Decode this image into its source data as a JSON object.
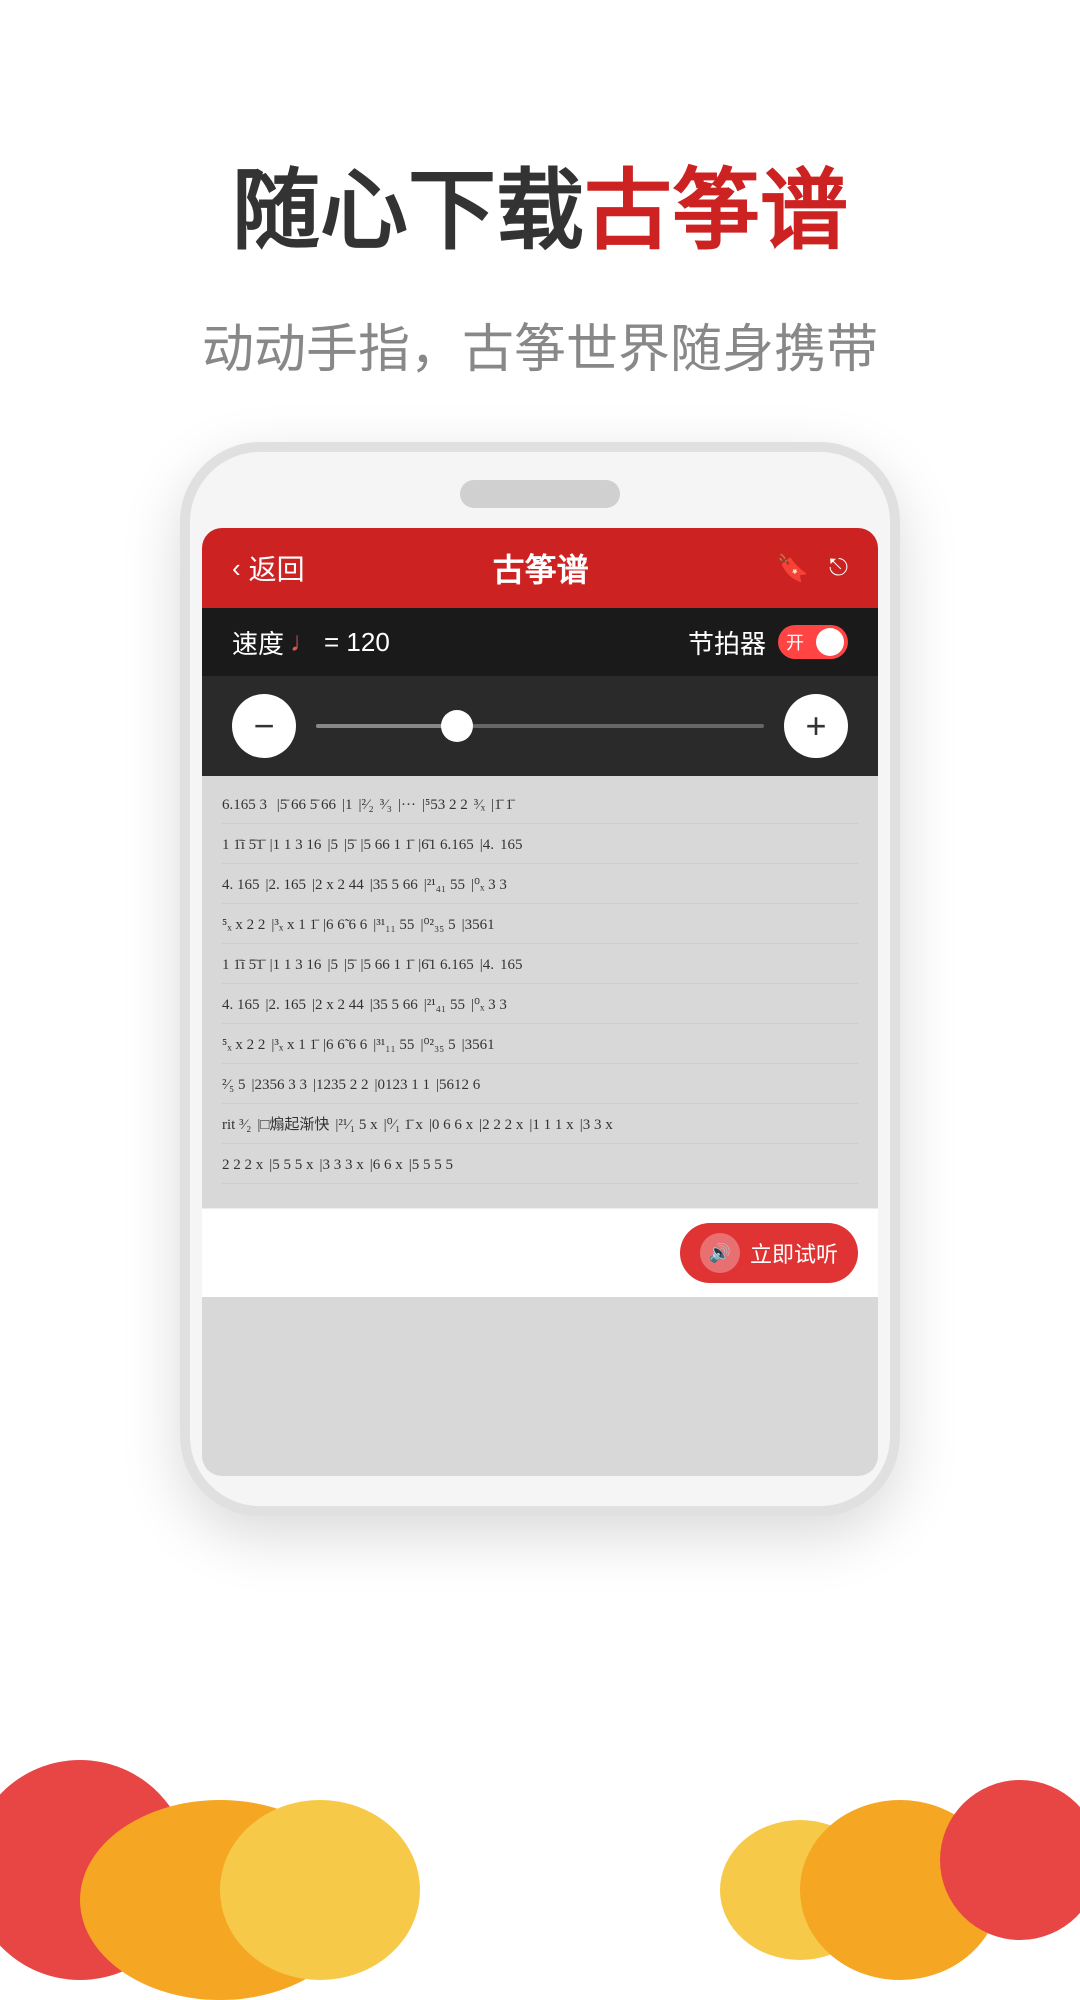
{
  "header": {
    "main_title_part1": "随心下载",
    "main_title_part2": "古筝谱",
    "subtitle": "动动手指，古筝世界随身携带"
  },
  "app": {
    "back_label": "返回",
    "title": "古筝谱",
    "tempo_label": "速度",
    "tempo_note_symbol": "♩",
    "tempo_equals": "= 120",
    "metronome_label": "节拍器",
    "toggle_label": "开",
    "minus_label": "−",
    "plus_label": "+",
    "listen_label": "立即试听",
    "sheet_rows": [
      "6.165 3  |5̄ 66 5̄ 66 |1  |²/₂  ³/₃  |···  | ⁵53 2 2  ³/x  |1̄  1̄",
      "1 1̄ī  5̄1̄  |1 1·  3·16 |5  |5̄   |5 66 1 1̄· |6̄·1·  6.165|4.   165",
      "4.   165|2.   165|2 x  2 44|35  5  66|²¹/₄₁  55|⁰/x  3 3",
      "⁵/x x  2 2|³/x x  1 1̄|6 6̃  6 6|³¹/₁₁  55|⁰²/₃₅  5 3561",
      "1 1̄ī  5̄1̄  |1 1·  3·16|5  |5̄   |5 66 1 1̄· |6̄·1  6.165|4.   165",
      "4.   165|2.   165|2 x  2 44|35  5  66|²¹/₄₁  55|⁰/x  3 3",
      "⁵/x x  2 2|³/x x  1 1̄|6 6̃  6 6|³¹/₁₁  55|⁰²/₃₅  5 3561",
      "²/₅ 5  |2356  3 3|1235  2 2|0123  1 1|5612  6",
      "rit  ³/₂  |□煽起渐快  |²¹/₁  5 x|⁰/₁  1̄  x|0 6  6  x|2 2  2 x|1 1  1 x| 3 3 x",
      "2 2  2 x|5 5  5 x|3 3  3 x|6 6  x|5 5  5 5|"
    ]
  },
  "colors": {
    "accent": "#cc2222",
    "dark_bar": "#1a1a1a",
    "slider_bg": "#2a2a2a",
    "sheet_bg": "#d8d8d8"
  }
}
